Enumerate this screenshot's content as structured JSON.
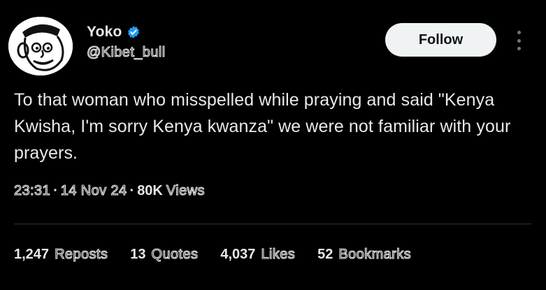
{
  "author": {
    "display_name": "Yoko",
    "handle": "@Kibet_bull",
    "verified_icon": "verified-badge-icon",
    "avatar": "cartoon-face-avatar"
  },
  "actions": {
    "follow_label": "Follow",
    "more_icon": "more-options-icon"
  },
  "tweet": {
    "text": "To that woman who misspelled while praying and said \"Kenya Kwisha, I'm sorry Kenya kwanza\" we were not familiar with your prayers.",
    "time": "23:31",
    "date": "14 Nov 24",
    "separator": "·",
    "views_count": "80K",
    "views_label": "Views"
  },
  "stats": [
    {
      "count": "1,247",
      "label": "Reposts"
    },
    {
      "count": "13",
      "label": "Quotes"
    },
    {
      "count": "4,037",
      "label": "Likes"
    },
    {
      "count": "52",
      "label": "Bookmarks"
    }
  ],
  "colors": {
    "background": "#000000",
    "text": "#e7e9ea",
    "verified": "#1d9bf0",
    "follow_bg": "#eff3f4",
    "divider": "#2f3336"
  }
}
